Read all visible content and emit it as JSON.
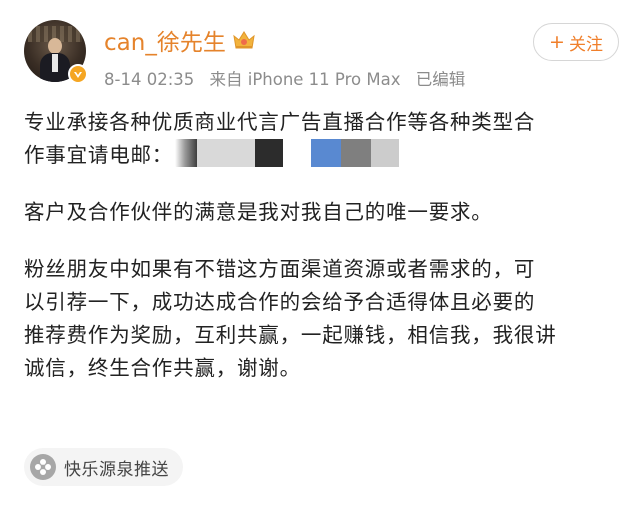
{
  "post": {
    "author": {
      "username": "can_徐先生",
      "avatar_icon": "user-avatar",
      "verified_icon": "verified-badge-icon",
      "vip_icon": "crown-icon",
      "verified_color": "#f5a623",
      "name_color": "#e5832b"
    },
    "meta": {
      "date": "8-14 02:35",
      "device": "来自 iPhone 11 Pro Max",
      "edited": "已编辑"
    },
    "follow_button": {
      "plus": "+",
      "label": "关注"
    },
    "body": {
      "p1_line1": "专业承接各种优质商业代言广告直播合作等各种类型合",
      "p1_line2": "作事宜请电邮：",
      "p2": "客户及合作伙伴的满意是我对我自己的唯一要求。",
      "p3_line1": "粉丝朋友中如果有不错这方面渠道资源或者需求的，可",
      "p3_line2": "以引荐一下，成功达成合作的会给予合适得体且必要的",
      "p3_line3": "推荐费作为奖励，互利共赢，一起赚钱，相信我，我很讲",
      "p3_line4": "诚信，终生合作共赢，谢谢。"
    },
    "source": {
      "icon": "flower-icon",
      "label": "快乐源泉推送"
    }
  }
}
